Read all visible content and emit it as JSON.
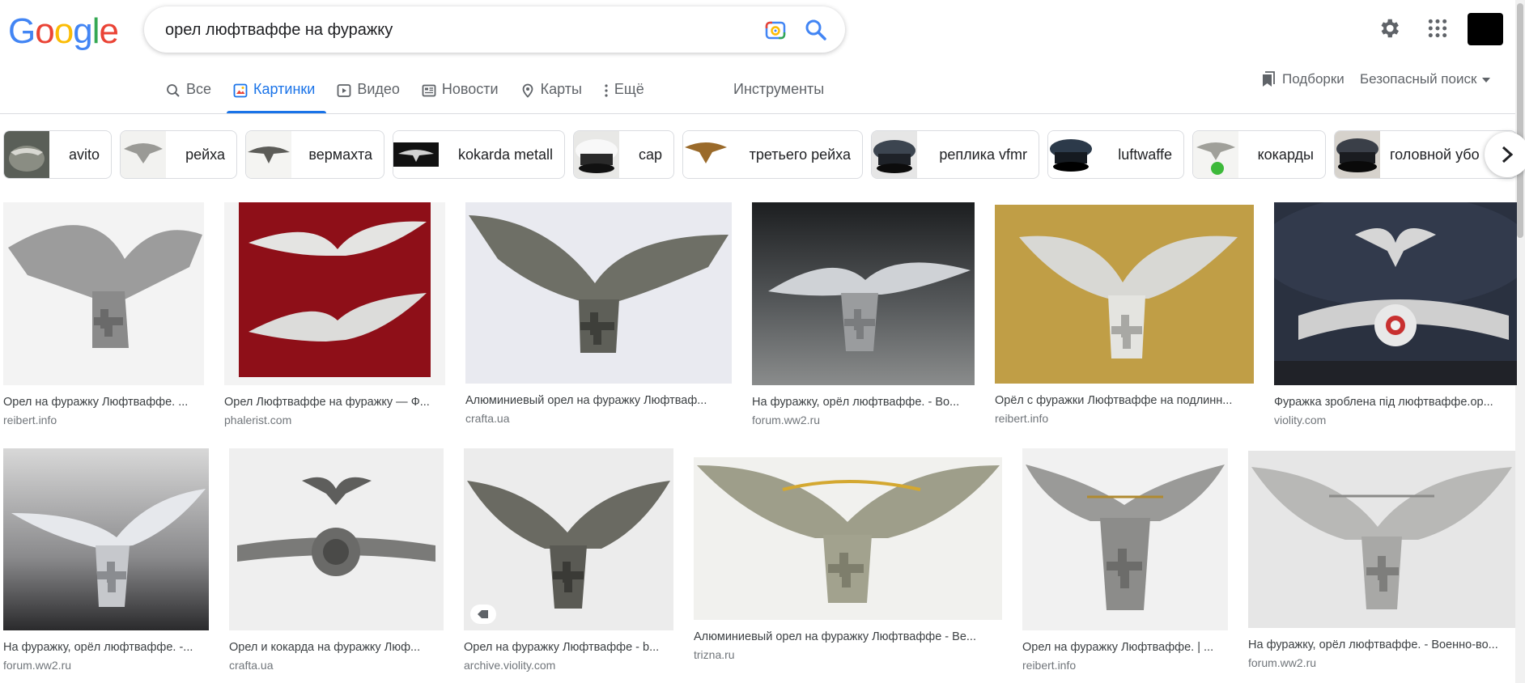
{
  "logo": "Google",
  "search": {
    "query": "орел люфтваффе на фуражку"
  },
  "tabs": [
    {
      "label": "Все",
      "icon": "search-icon",
      "active": false
    },
    {
      "label": "Картинки",
      "icon": "image-icon",
      "active": true
    },
    {
      "label": "Видео",
      "icon": "video-icon",
      "active": false
    },
    {
      "label": "Новости",
      "icon": "news-icon",
      "active": false
    },
    {
      "label": "Карты",
      "icon": "map-pin-icon",
      "active": false
    },
    {
      "label": "Ещё",
      "icon": "more-vert-icon",
      "active": false
    }
  ],
  "tools": "Инструменты",
  "collections": "Подборки",
  "safesearch": "Безопасный поиск",
  "chips": [
    {
      "label": "avito"
    },
    {
      "label": "рейха"
    },
    {
      "label": "вермахта"
    },
    {
      "label": "kokarda metall"
    },
    {
      "label": "cap"
    },
    {
      "label": "третьего рейха"
    },
    {
      "label": "реплика vfmr"
    },
    {
      "label": "luftwaffe"
    },
    {
      "label": "кокарды"
    },
    {
      "label": "головной убо"
    }
  ],
  "results": [
    {
      "title": "Орел на фуражку Люфтваффе. ...",
      "source": "reibert.info"
    },
    {
      "title": "Орел Люфтваффе на фуражку — Ф...",
      "source": "phalerist.com"
    },
    {
      "title": "Алюминиевый орел на фуражку Люфтваф...",
      "source": "crafta.ua"
    },
    {
      "title": "На фуражку, орёл люфтваффе. - Во...",
      "source": "forum.ww2.ru"
    },
    {
      "title": "Орёл с фуражки Люфтваффе на подлинн...",
      "source": "reibert.info"
    },
    {
      "title": "Фуражка зроблена під люфтваффе.ор...",
      "source": "violity.com"
    },
    {
      "title": "На фуражку, орёл люфтваффе. -...",
      "source": "forum.ww2.ru"
    },
    {
      "title": "Орел и кокарда на фуражку Люф...",
      "source": "crafta.ua"
    },
    {
      "title": "Орел на фуражку Люфтваффе - b...",
      "source": "archive.violity.com"
    },
    {
      "title": "Алюминиевый орел на фуражку Люфтваффе - Ве...",
      "source": "trizna.ru"
    },
    {
      "title": "Орел на фуражку Люфтваффе. | ...",
      "source": "reibert.info"
    },
    {
      "title": "На фуражку, орёл люфтваффе. - Военно-во...",
      "source": "forum.ww2.ru"
    }
  ]
}
